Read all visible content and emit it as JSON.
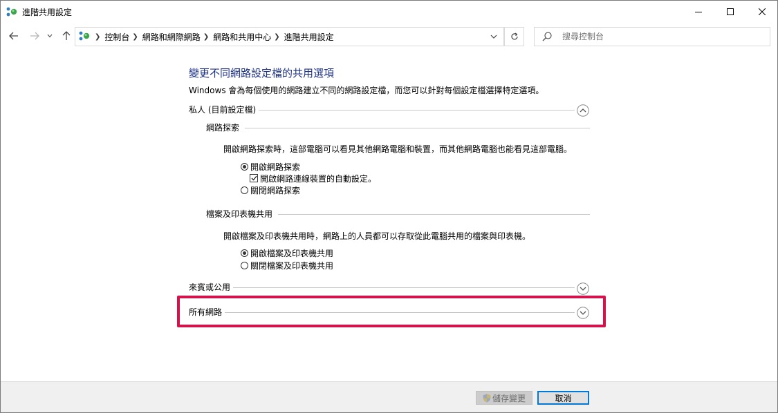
{
  "window": {
    "title": "進階共用設定"
  },
  "address_bar": {
    "crumbs": [
      "控制台",
      "網路和網際網路",
      "網路和共用中心",
      "進階共用設定"
    ]
  },
  "search": {
    "placeholder": "搜尋控制台"
  },
  "main": {
    "heading": "變更不同網路設定檔的共用選項",
    "description": "Windows 會為每個使用的網路建立不同的網路設定檔，而您可以針對每個設定檔選擇特定選項。",
    "profiles": [
      {
        "label": "私人 (目前設定檔)",
        "expanded": true,
        "sections": [
          {
            "label": "網路探索",
            "description": "開啟網路探索時，這部電腦可以看見其他網路電腦和裝置，而其他網路電腦也能看見這部電腦。",
            "options": [
              {
                "label": "開啟網路探索",
                "selected": true
              },
              {
                "label": "開啟網路連線裝置的自動設定。",
                "checked": true
              },
              {
                "label": "關閉網路探索",
                "selected": false
              }
            ]
          },
          {
            "label": "檔案及印表機共用",
            "description": "開啟檔案及印表機共用時，網路上的人員都可以存取從此電腦共用的檔案與印表機。",
            "options": [
              {
                "label": "開啟檔案及印表機共用",
                "selected": true
              },
              {
                "label": "關閉檔案及印表機共用",
                "selected": false
              }
            ]
          }
        ]
      },
      {
        "label": "來賓或公用",
        "expanded": false
      },
      {
        "label": "所有網路",
        "expanded": false
      }
    ]
  },
  "footer": {
    "save_label": "儲存變更",
    "cancel_label": "取消"
  },
  "colors": {
    "heading": "#1e3287",
    "highlight": "#d2144a",
    "focus": "#0078d7"
  }
}
